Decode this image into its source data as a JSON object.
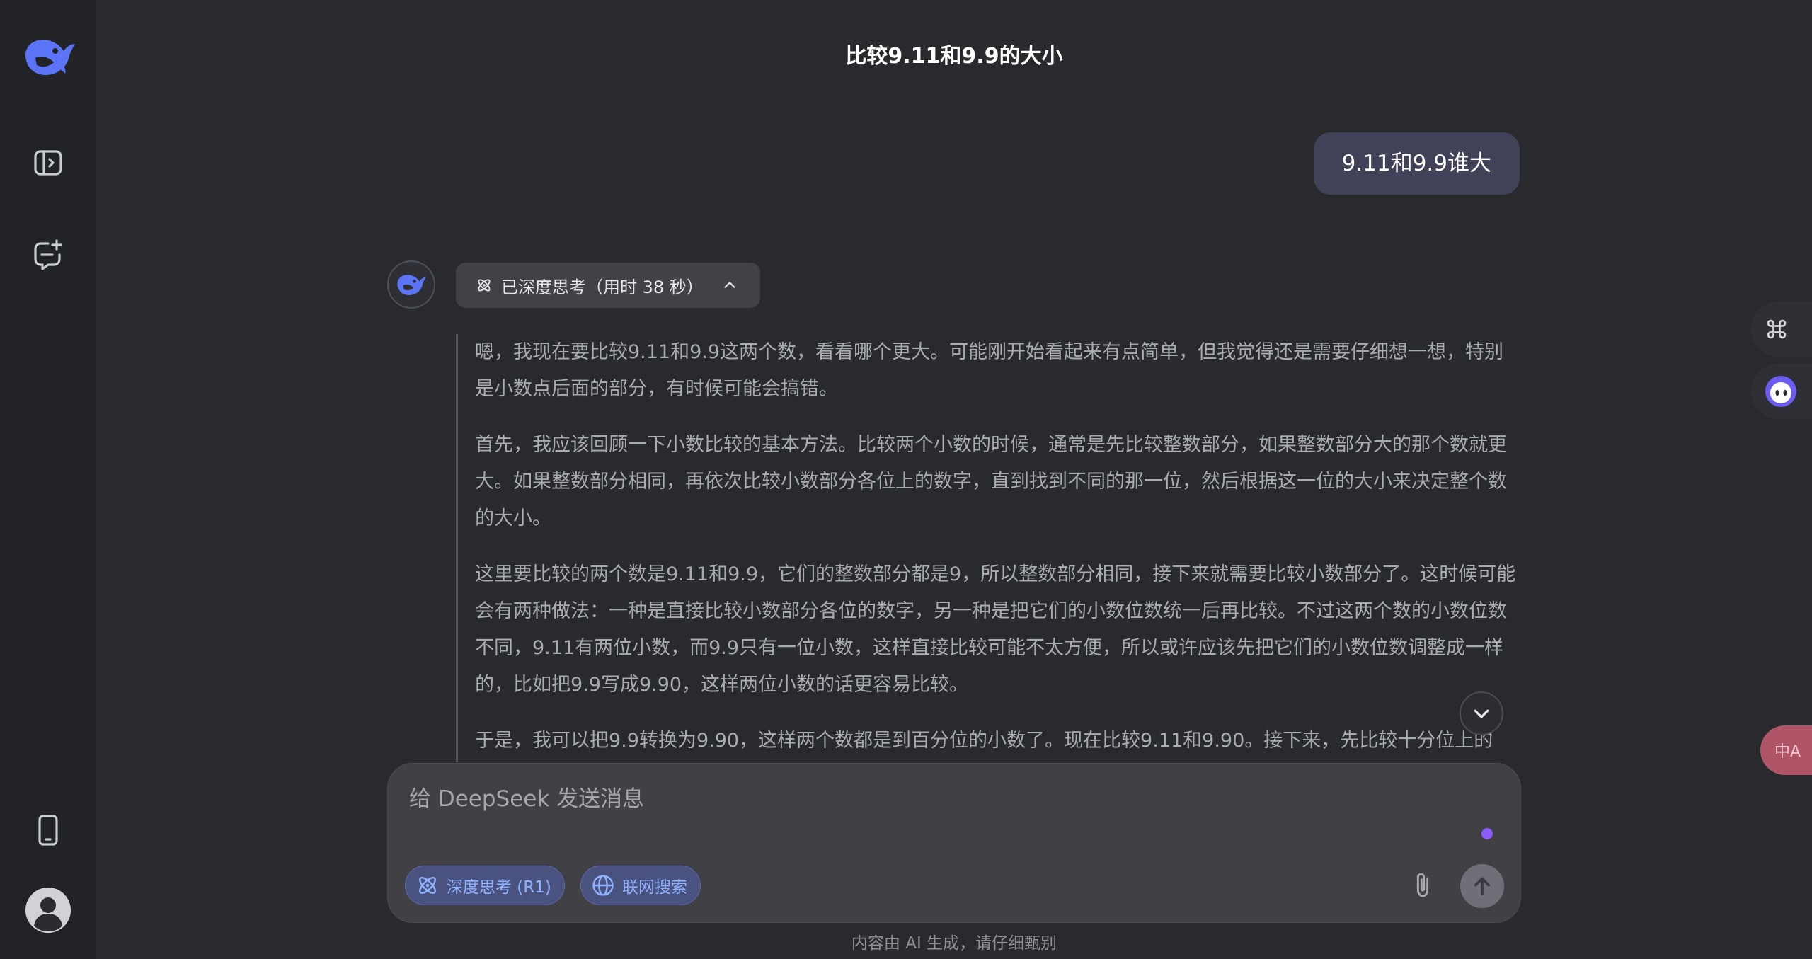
{
  "sidebar": {
    "logo": "deepseek-whale-logo",
    "items": [
      {
        "icon": "sidebar-toggle-icon"
      },
      {
        "icon": "new-chat-icon"
      },
      {
        "icon": "mobile-app-icon"
      }
    ],
    "avatar": "user-avatar-icon"
  },
  "conversation": {
    "title": "比较9.11和9.9的大小",
    "user_message": "9.11和9.9谁大",
    "thinking_chip": "已深度思考（用时 38 秒）",
    "thinking_paragraphs": [
      "嗯，我现在要比较9.11和9.9这两个数，看看哪个更大。可能刚开始看起来有点简单，但我觉得还是需要仔细想一想，特别是小数点后面的部分，有时候可能会搞错。",
      "首先，我应该回顾一下小数比较的基本方法。比较两个小数的时候，通常是先比较整数部分，如果整数部分大的那个数就更大。如果整数部分相同，再依次比较小数部分各位上的数字，直到找到不同的那一位，然后根据这一位的大小来决定整个数的大小。",
      "这里要比较的两个数是9.11和9.9，它们的整数部分都是9，所以整数部分相同，接下来就需要比较小数部分了。这时候可能会有两种做法：一种是直接比较小数部分各位的数字，另一种是把它们的小数位数统一后再比较。不过这两个数的小数位数不同，9.11有两位小数，而9.9只有一位小数，这样直接比较可能不太方便，所以或许应该先把它们的小数位数调整成一样的，比如把9.9写成9.90，这样两位小数的话更容易比较。",
      "于是，我可以把9.9转换为9.90，这样两个数都是到百分位的小数了。现在比较9.11和9.90。接下来，先比较十分位上的"
    ]
  },
  "composer": {
    "placeholder": "给 DeepSeek 发送消息",
    "deep_think_label": "深度思考 (R1)",
    "web_search_label": "联网搜索"
  },
  "footer": {
    "disclaimer": "内容由 AI 生成，请仔细甄别"
  },
  "floating": {
    "translate_label": "中A"
  },
  "colors": {
    "accent": "#4d6bfe",
    "pill_text": "#8fb2ff",
    "send_button": "#6f7077"
  }
}
